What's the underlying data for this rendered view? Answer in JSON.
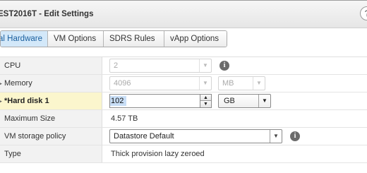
{
  "window": {
    "title": "EST2016T - Edit Settings",
    "help_glyph": "?"
  },
  "tabs": [
    {
      "label": "al Hardware",
      "active": true
    },
    {
      "label": "VM Options",
      "active": false
    },
    {
      "label": "SDRS Rules",
      "active": false
    },
    {
      "label": "vApp Options",
      "active": false
    }
  ],
  "rows": {
    "cpu": {
      "label": "CPU",
      "value": "2",
      "disabled": true
    },
    "memory": {
      "label": "Memory",
      "value": "4096",
      "unit": "MB",
      "disabled": true
    },
    "hard_disk": {
      "label": "*Hard disk 1",
      "value": "102",
      "unit": "GB"
    },
    "max_size": {
      "label": "Maximum Size",
      "value": "4.57 TB"
    },
    "storage_policy": {
      "label": "VM storage policy",
      "value": "Datastore Default"
    },
    "type": {
      "label": "Type",
      "value": "Thick provision lazy zeroed"
    }
  },
  "icons": {
    "info": "i",
    "dropdown_arrow": "▼",
    "spin_up": "▲",
    "spin_down": "▼"
  },
  "colors": {
    "active_tab_bg": "#d3e8f9",
    "highlight_row_bg": "#fbf6cd",
    "selected_text_bg": "#c8def6"
  }
}
